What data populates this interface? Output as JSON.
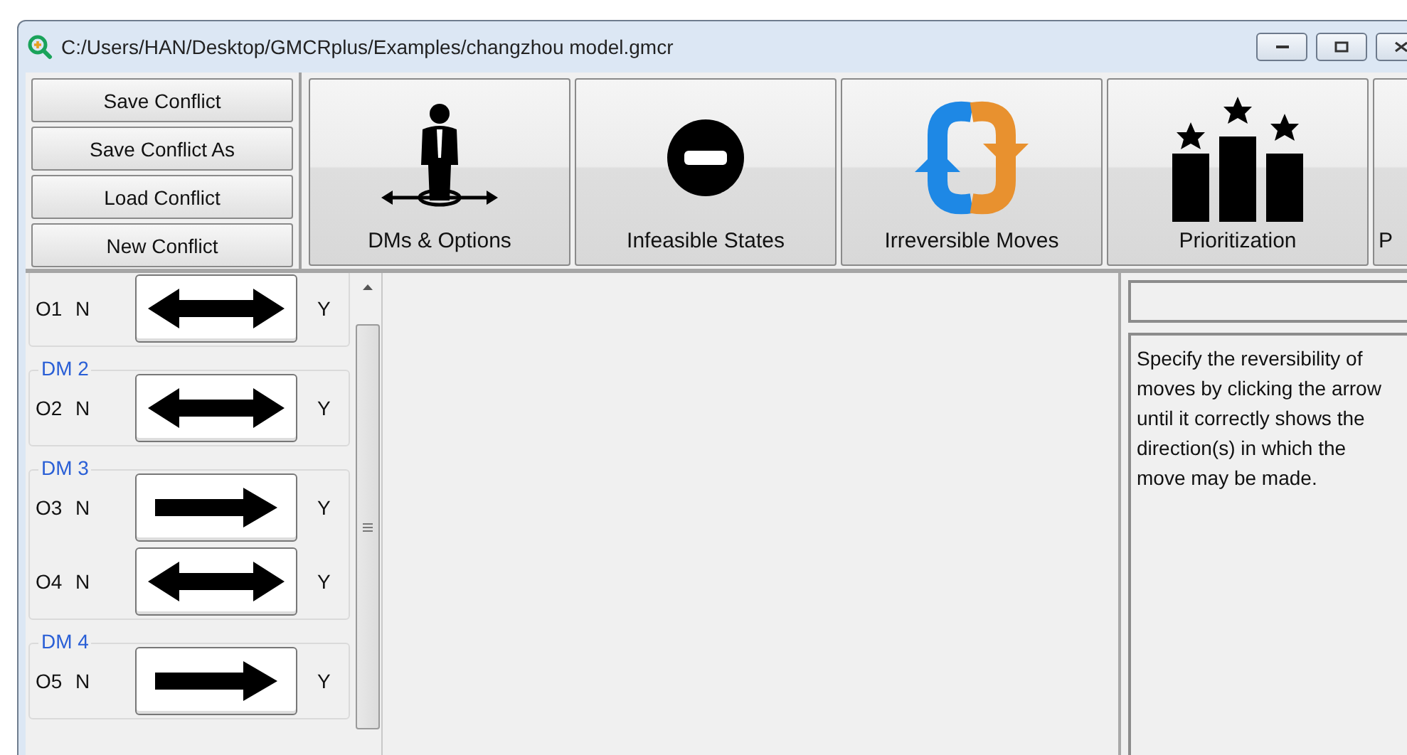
{
  "window": {
    "title": "C:/Users/HAN/Desktop/GMCRplus/Examples/changzhou model.gmcr"
  },
  "file_buttons": [
    "Save Conflict",
    "Save Conflict As",
    "Load Conflict",
    "New Conflict"
  ],
  "toolbar": [
    {
      "label": "DMs & Options",
      "kind": "person"
    },
    {
      "label": "Infeasible States",
      "kind": "forbidden"
    },
    {
      "label": "Irreversible Moves",
      "kind": "reverse"
    },
    {
      "label": "Prioritization",
      "kind": "podium"
    },
    {
      "label": "P",
      "kind": "none"
    }
  ],
  "groups": [
    {
      "options": [
        {
          "name": "O1",
          "from": "N",
          "to": "Y",
          "kind": "double"
        }
      ]
    },
    {
      "label": "DM 2",
      "options": [
        {
          "name": "O2",
          "from": "N",
          "to": "Y",
          "kind": "double"
        }
      ]
    },
    {
      "label": "DM 3",
      "options": [
        {
          "name": "O3",
          "from": "N",
          "to": "Y",
          "kind": "forward"
        },
        {
          "name": "O4",
          "from": "N",
          "to": "Y",
          "kind": "double"
        }
      ]
    },
    {
      "label": "DM 4",
      "options": [
        {
          "name": "O5",
          "from": "N",
          "to": "Y",
          "kind": "forward"
        }
      ]
    }
  ],
  "help_text": "Specify the reversibility of moves by clicking the arrow until it correctly shows the direction(s) in which the move may be made."
}
